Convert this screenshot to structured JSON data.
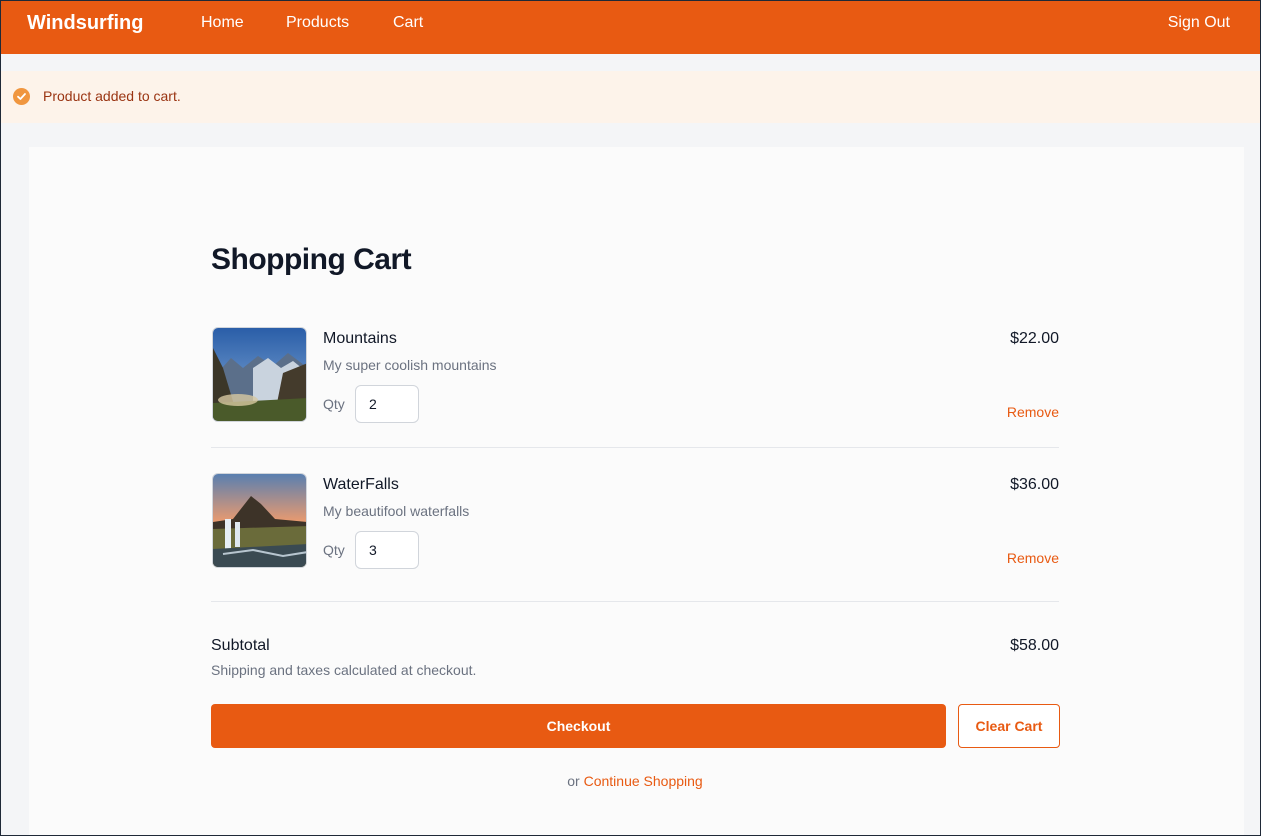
{
  "nav": {
    "brand": "Windsurfing",
    "home": "Home",
    "products": "Products",
    "cart": "Cart",
    "sign_out": "Sign Out"
  },
  "flash": {
    "message": "Product added to cart.",
    "icon": "check-circle-icon"
  },
  "cart": {
    "title": "Shopping Cart",
    "qty_label": "Qty",
    "remove_label": "Remove",
    "items": [
      {
        "name": "Mountains",
        "description": "My super coolish mountains",
        "qty": "2",
        "price": "$22.00"
      },
      {
        "name": "WaterFalls",
        "description": "My beautifool waterfalls",
        "qty": "3",
        "price": "$36.00"
      }
    ],
    "subtotal_label": "Subtotal",
    "subtotal_value": "$58.00",
    "shipping_note": "Shipping and taxes calculated at checkout.",
    "checkout_label": "Checkout",
    "clear_label": "Clear Cart",
    "or_text": "or",
    "continue_label": "Continue Shopping"
  },
  "colors": {
    "accent": "#e85a12",
    "flash_bg": "#fdf3ea",
    "flash_text": "#9a3412"
  }
}
